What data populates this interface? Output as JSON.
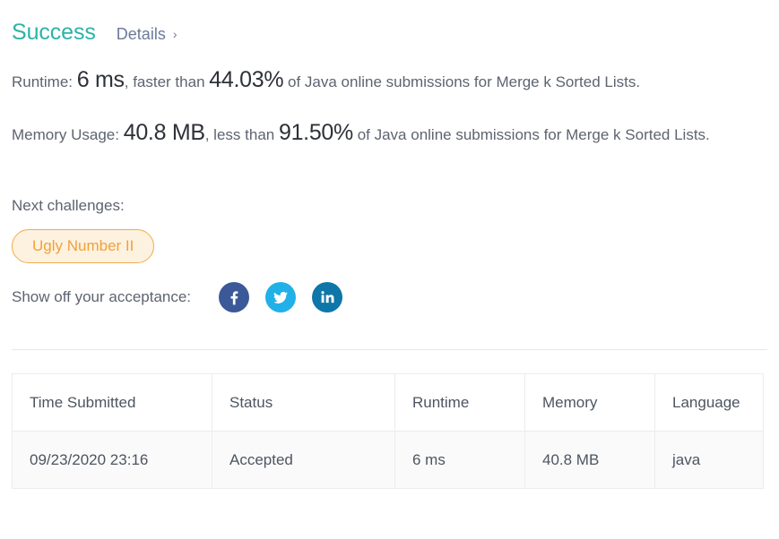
{
  "header": {
    "status_title": "Success",
    "details_label": "Details",
    "details_chevron": "›"
  },
  "runtime_line": {
    "prefix": "Runtime:",
    "value": "6 ms",
    "middle": ", faster than",
    "percent": "44.03%",
    "suffix": "of Java online submissions for Merge k Sorted Lists."
  },
  "memory_line": {
    "prefix": "Memory Usage:",
    "value": "40.8 MB",
    "middle": ", less than",
    "percent": "91.50%",
    "suffix": "of Java online submissions for Merge k Sorted Lists."
  },
  "next_challenges": {
    "label": "Next challenges:",
    "items": [
      {
        "label": "Ugly Number II"
      }
    ]
  },
  "share": {
    "label": "Show off your acceptance:",
    "networks": [
      {
        "name": "facebook",
        "icon": "facebook-icon",
        "color": "#3b5998"
      },
      {
        "name": "twitter",
        "icon": "twitter-icon",
        "color": "#22b0e8"
      },
      {
        "name": "linkedin",
        "icon": "linkedin-icon",
        "color": "#0e76a8"
      }
    ]
  },
  "submissions_table": {
    "columns": [
      "Time Submitted",
      "Status",
      "Runtime",
      "Memory",
      "Language"
    ],
    "rows": [
      {
        "time_submitted": "09/23/2020 23:16",
        "status": "Accepted",
        "runtime": "6 ms",
        "memory": "40.8 MB",
        "language": "java"
      }
    ]
  },
  "colors": {
    "success_teal": "#2cb3a6",
    "accent_orange": "#f0a03c",
    "badge_bg": "#fdf2e0",
    "text_gray": "#5d6470",
    "text_dark": "#2d3138",
    "row_bg": "#fafafa",
    "border": "#ececec"
  }
}
